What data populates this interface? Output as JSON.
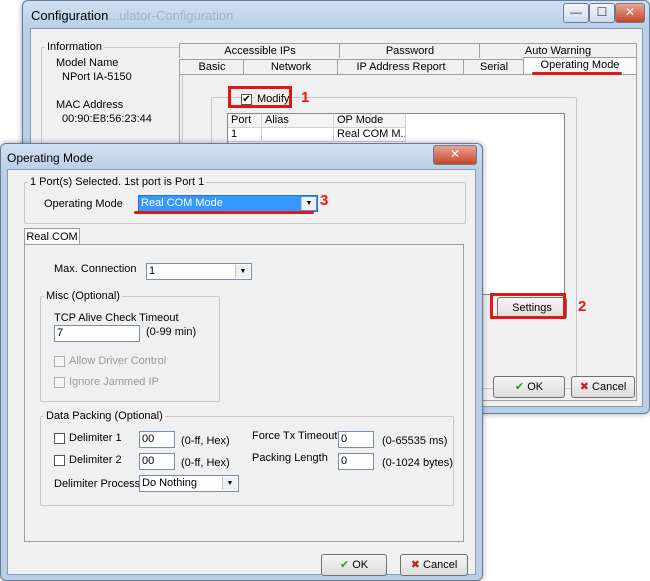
{
  "config_window": {
    "title": "Configuration",
    "title_suffix": "...ulator-Configuration",
    "caption_buttons": {
      "minimize": "—",
      "maximize": "☐",
      "close": "✕"
    },
    "info": {
      "legend": "Information",
      "model_name_label": "Model Name",
      "model_name_value": "NPort IA-5150",
      "mac_label": "MAC Address",
      "mac_value": "00:90:E8:56:23:44"
    },
    "tabs_row1": [
      "Accessible IPs",
      "Password",
      "Auto Warning"
    ],
    "tabs_row2": [
      "Basic",
      "Network",
      "IP Address Report",
      "Serial",
      "Operating Mode"
    ],
    "modify_label": "Modify",
    "grid": {
      "headers": [
        "Port",
        "Alias",
        "OP Mode"
      ],
      "rows": [
        [
          "1",
          "",
          "Real COM M..."
        ]
      ]
    },
    "settings_button": "Settings",
    "ok_button": "OK",
    "cancel_button": "Cancel"
  },
  "opmode_window": {
    "title": "Operating Mode",
    "close_glyph": "✕",
    "selection_legend": "1 Port(s) Selected. 1st port is Port 1",
    "operating_mode_label": "Operating Mode",
    "operating_mode_value": "Real COM Mode",
    "tab_label": "Real COM",
    "max_connection_label": "Max. Connection",
    "max_connection_value": "1",
    "misc": {
      "legend": "Misc (Optional)",
      "tcp_alive_label": "TCP Alive Check Timeout",
      "tcp_alive_value": "7",
      "tcp_alive_hint": "(0-99 min)",
      "allow_driver_control": "Allow Driver Control",
      "ignore_jammed_ip": "Ignore Jammed IP"
    },
    "packing": {
      "legend": "Data Packing (Optional)",
      "delimiter1_label": "Delimiter 1",
      "delimiter1_value": "00",
      "delimiter1_hint": "(0-ff, Hex)",
      "delimiter2_label": "Delimiter 2",
      "delimiter2_value": "00",
      "delimiter2_hint": "(0-ff, Hex)",
      "force_tx_label": "Force Tx Timeout",
      "force_tx_value": "0",
      "force_tx_hint": "(0-65535 ms)",
      "packing_length_label": "Packing Length",
      "packing_length_value": "0",
      "packing_length_hint": "(0-1024 bytes)",
      "delimiter_process_label": "Delimiter Process",
      "delimiter_process_value": "Do Nothing"
    },
    "ok_button": "OK",
    "cancel_button": "Cancel"
  },
  "annotations": {
    "one": "1",
    "two": "2",
    "three": "3"
  },
  "icons": {
    "check": "✔",
    "cancel": "✖",
    "combo_arrow": "▼",
    "checkmark": "✔"
  },
  "colors": {
    "annotation_red": "#e01818",
    "selection_blue": "#3399ff",
    "ok_green": "#2a9a2a",
    "cancel_red": "#c62020"
  }
}
